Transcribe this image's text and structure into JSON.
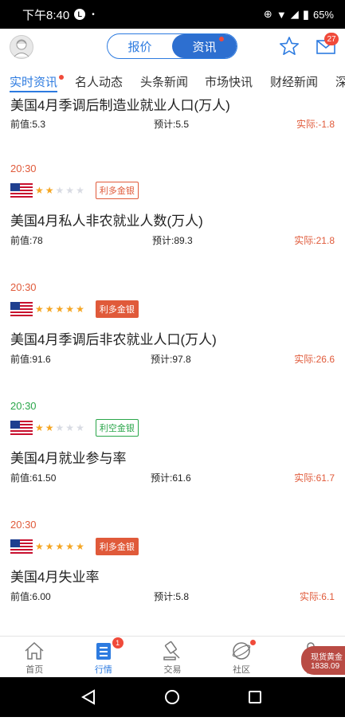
{
  "status_bar": {
    "time": "下午8:40",
    "line_app": "LINE",
    "dot": "•",
    "battery": "65%"
  },
  "header": {
    "segments": [
      {
        "label": "报价",
        "active": false
      },
      {
        "label": "资讯",
        "active": true
      }
    ],
    "mail_badge": "27",
    "star_icon": "star-outline-icon",
    "mail_icon": "mail-icon"
  },
  "tabs": [
    {
      "label": "实时资讯",
      "active": true
    },
    {
      "label": "名人动态",
      "active": false
    },
    {
      "label": "头条新闻",
      "active": false
    },
    {
      "label": "市场快讯",
      "active": false
    },
    {
      "label": "财经新闻",
      "active": false
    },
    {
      "label": "深",
      "active": false
    }
  ],
  "feed": [
    {
      "time": "",
      "stars": 0,
      "tag": "",
      "title": "美国4月季调后制造业就业人口(万人)",
      "prev": "前值:5.3",
      "forecast": "预计:5.5",
      "actual": "实际:-1.8"
    },
    {
      "time": "20:30",
      "time_color": "#e05a3a",
      "stars": 2,
      "tag": "利多金银",
      "tag_style": "outline-red",
      "title": "美国4月私人非农就业人数(万人)",
      "prev": "前值:78",
      "forecast": "预计:89.3",
      "actual": "实际:21.8"
    },
    {
      "time": "20:30",
      "time_color": "#e05a3a",
      "stars": 5,
      "tag": "利多金银",
      "tag_style": "filled-red",
      "title": "美国4月季调后非农就业人口(万人)",
      "prev": "前值:91.6",
      "forecast": "预计:97.8",
      "actual": "实际:26.6"
    },
    {
      "time": "20:30",
      "time_color": "#2aa64a",
      "stars": 2,
      "tag": "利空金银",
      "tag_style": "outline-green",
      "title": "美国4月就业参与率",
      "prev": "前值:61.50",
      "forecast": "预计:61.6",
      "actual": "实际:61.7"
    },
    {
      "time": "20:30",
      "time_color": "#e05a3a",
      "stars": 5,
      "tag": "利多金银",
      "tag_style": "filled-red",
      "title": "美国4月失业率",
      "prev": "前值:6.00",
      "forecast": "预计:5.8",
      "actual": "实际:6.1"
    }
  ],
  "bottom_nav": [
    {
      "label": "首页",
      "icon": "home-icon",
      "active": false
    },
    {
      "label": "行情",
      "icon": "quotes-icon",
      "active": true,
      "badge": "1"
    },
    {
      "label": "交易",
      "icon": "trade-icon",
      "active": false
    },
    {
      "label": "社区",
      "icon": "community-icon",
      "active": false,
      "dot": true
    },
    {
      "label": "我",
      "icon": "profile-icon",
      "active": false
    }
  ],
  "floating_price": {
    "name": "现货黄金",
    "value": "1838.09"
  },
  "colors": {
    "accent": "#2d7be0",
    "red": "#e05a3a",
    "green": "#2aa64a"
  }
}
